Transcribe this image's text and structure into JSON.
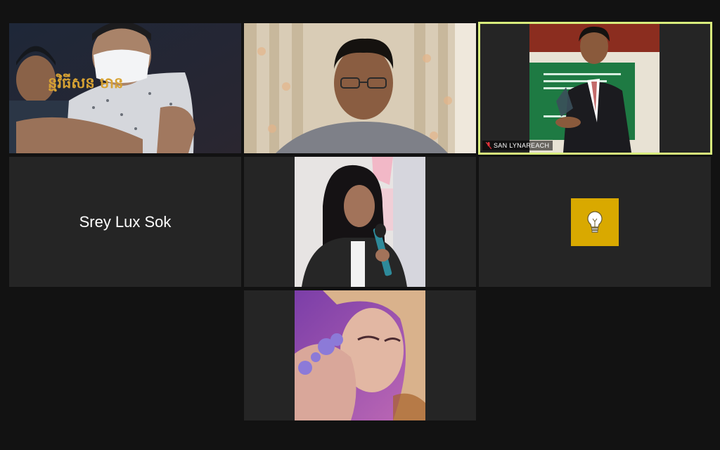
{
  "participants": [
    {
      "id": "p1",
      "name": "",
      "type": "video",
      "scene": "two-people-masked",
      "overlay_text": "ន្មវិធីសន                    មាន",
      "overlay_text_color": "#d7a233"
    },
    {
      "id": "p2",
      "name": "",
      "type": "video",
      "scene": "man-with-glasses-curtains"
    },
    {
      "id": "p3",
      "name": "SAN LYNAREACH",
      "type": "video",
      "scene": "man-in-suit-with-award",
      "active_speaker": true,
      "muted": true
    },
    {
      "id": "p4",
      "name": "Srey Lux Sok",
      "type": "name-only"
    },
    {
      "id": "p5",
      "name": "",
      "type": "photo",
      "scene": "woman-speaking-microphone"
    },
    {
      "id": "p6",
      "name": "",
      "type": "avatar",
      "icon": "lightbulb-icon",
      "avatar_color": "#d9a900"
    },
    {
      "id": "p7",
      "name": "",
      "type": "photo",
      "scene": "purple-portrait-flowers"
    }
  ],
  "colors": {
    "background": "#121212",
    "tile": "#252525",
    "active_border": "#d8ec7c",
    "muted_icon": "#e0323a"
  }
}
